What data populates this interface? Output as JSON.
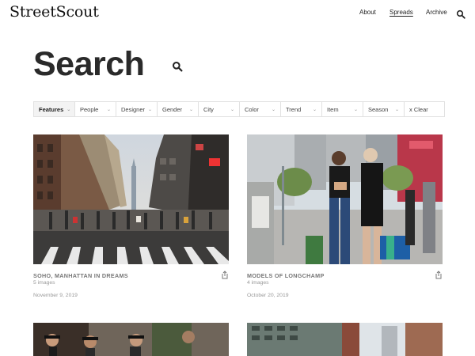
{
  "brand": {
    "logo": "StreetScout"
  },
  "nav": {
    "about": "About",
    "spreads": "Spreads",
    "archive": "Archive"
  },
  "icons": {
    "header_search": "search-icon",
    "title_search": "search-icon",
    "share": "share-icon",
    "chevron": "chevron-down-icon"
  },
  "page": {
    "title": "Search"
  },
  "filters": {
    "items": [
      {
        "label": "Features"
      },
      {
        "label": "People"
      },
      {
        "label": "Designer"
      },
      {
        "label": "Gender"
      },
      {
        "label": "City"
      },
      {
        "label": "Color"
      },
      {
        "label": "Trend"
      },
      {
        "label": "Item"
      },
      {
        "label": "Season"
      },
      {
        "label": "x Clear"
      }
    ],
    "selected": "Features"
  },
  "cards": [
    {
      "title": "SOHO, MANHATTAN IN DREAMS",
      "count": "5 images",
      "date": "November 9, 2019"
    },
    {
      "title": "MODELS OF LONGCHAMP",
      "count": "4 images",
      "date": "October 20, 2019"
    },
    {
      "title": "",
      "count": "",
      "date": ""
    },
    {
      "title": "",
      "count": "",
      "date": ""
    }
  ],
  "colors": {
    "text_dark": "#2a2a2a",
    "meta_gray": "#999999",
    "border": "#e1e1e1"
  }
}
